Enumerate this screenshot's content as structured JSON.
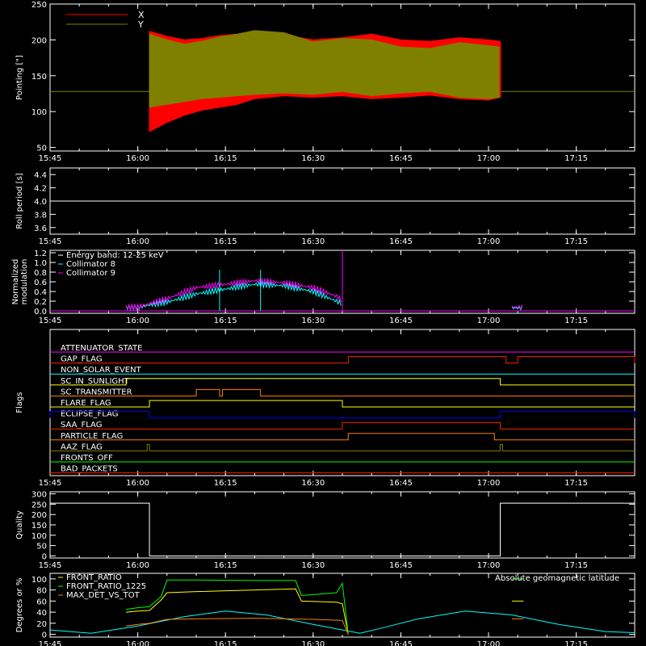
{
  "chart_data": [
    {
      "type": "area",
      "ylabel": "Pointing [\"]",
      "ylim": [
        45,
        250
      ],
      "yticks": [
        50,
        100,
        150,
        200,
        250
      ],
      "x_range": [
        "15:45",
        "17:25"
      ],
      "x_ticks": [
        "15:45",
        "16:00",
        "16:15",
        "16:30",
        "16:45",
        "17:00",
        "17:15"
      ],
      "legend": {
        "placement": "top-left",
        "entries": [
          {
            "name": "X",
            "color": "#ff0000"
          },
          {
            "name": "Y",
            "color": "#808000"
          }
        ]
      },
      "baseline": 128,
      "envelope_x": [
        "16:02",
        "16:05",
        "16:08",
        "16:11",
        "16:14",
        "16:17",
        "16:20",
        "16:25",
        "16:30",
        "16:35",
        "16:40",
        "16:45",
        "16:50",
        "16:55",
        "17:00",
        "17:02"
      ],
      "series": [
        {
          "name": "X",
          "color": "#ff0000",
          "upper": [
            212,
            205,
            200,
            202,
            206,
            208,
            210,
            207,
            200,
            203,
            208,
            200,
            198,
            203,
            200,
            198
          ],
          "lower": [
            72,
            85,
            95,
            102,
            106,
            110,
            118,
            122,
            120,
            122,
            118,
            120,
            123,
            118,
            116,
            120
          ]
        },
        {
          "name": "Y",
          "color": "#808000",
          "upper": [
            208,
            200,
            194,
            198,
            204,
            208,
            213,
            210,
            197,
            202,
            200,
            190,
            188,
            196,
            192,
            190
          ],
          "lower": [
            106,
            110,
            114,
            118,
            120,
            122,
            124,
            126,
            124,
            128,
            122,
            126,
            128,
            120,
            118,
            120
          ]
        }
      ]
    },
    {
      "type": "line",
      "ylabel": "Roll period [s]",
      "ylim": [
        3.5,
        4.5
      ],
      "yticks": [
        "3.6",
        "3.8",
        "4.0",
        "4.2",
        "4.4"
      ],
      "x_ticks": [
        "15:45",
        "16:00",
        "16:15",
        "16:30",
        "16:45",
        "17:00",
        "17:15"
      ],
      "series": [
        {
          "name": "",
          "color": "#ffffff",
          "x": [
            "15:45",
            "17:25"
          ],
          "y": [
            4.0,
            4.0
          ]
        }
      ]
    },
    {
      "type": "line",
      "ylabel": "Normalized modulation",
      "ylim": [
        -0.05,
        1.25
      ],
      "yticks": [
        "0.0",
        "0.2",
        "0.4",
        "0.6",
        "0.8",
        "1.0",
        "1.2"
      ],
      "x_ticks": [
        "15:45",
        "16:00",
        "16:15",
        "16:30",
        "16:45",
        "17:00",
        "17:15"
      ],
      "legend": {
        "placement": "top-left",
        "entries": [
          {
            "name": "Energy band: 12-25 keV",
            "color": "#ffffff"
          },
          {
            "name": "Collimator 8",
            "color": "#00ffff"
          },
          {
            "name": "Collimator 9",
            "color": "#ff00ff"
          }
        ]
      },
      "series": [
        {
          "name": "Collimator 8",
          "color": "#00ffff",
          "x": [
            "15:58",
            "16:00",
            "16:02",
            "16:05",
            "16:10",
            "16:15",
            "16:20",
            "16:25",
            "16:30",
            "16:34",
            "16:35",
            "17:04",
            "17:06"
          ],
          "y": [
            0.07,
            0.07,
            0.12,
            0.18,
            0.35,
            0.45,
            0.55,
            0.52,
            0.4,
            0.2,
            0.15,
            0.06,
            0.06
          ]
        },
        {
          "name": "Collimator 9",
          "color": "#ff00ff",
          "x": [
            "15:58",
            "16:00",
            "16:02",
            "16:05",
            "16:10",
            "16:15",
            "16:20",
            "16:25",
            "16:30",
            "16:34",
            "16:35",
            "17:04",
            "17:06"
          ],
          "y": [
            0.08,
            0.08,
            0.15,
            0.25,
            0.48,
            0.55,
            0.62,
            0.58,
            0.48,
            0.3,
            0.22,
            0.08,
            0.08
          ]
        }
      ]
    },
    {
      "type": "line",
      "ylabel": "Flags",
      "x_ticks": [
        "15:45",
        "16:00",
        "16:15",
        "16:30",
        "16:45",
        "17:00",
        "17:15"
      ],
      "flags": [
        {
          "label": "ATTENUATOR_STATE",
          "color": "#ff00ff",
          "steps": []
        },
        {
          "label": "GAP_FLAG",
          "color": "#ff2000",
          "steps": [
            [
              "16:36",
              "17:03"
            ],
            [
              "17:05",
              "17:25"
            ]
          ]
        },
        {
          "label": "NON_SOLAR_EVENT",
          "color": "#00ffff",
          "steps": []
        },
        {
          "label": "SC_IN_SUNLIGHT",
          "color": "#ffff00",
          "steps": [
            [
              "15:58",
              "17:02"
            ]
          ]
        },
        {
          "label": "SC_TRANSMITTER",
          "color": "#ff8000",
          "steps": [
            [
              "16:10",
              "16:14"
            ],
            [
              "16:14.5",
              "16:21"
            ]
          ]
        },
        {
          "label": "FLARE_FLAG",
          "color": "#ffff00",
          "steps": [
            [
              "16:02",
              "16:35"
            ]
          ]
        },
        {
          "label": "ECLIPSE_FLAG",
          "color": "#0000ff",
          "steps": [
            [
              "15:45",
              "16:02"
            ],
            [
              "17:02",
              "17:25"
            ]
          ]
        },
        {
          "label": "SAA_FLAG",
          "color": "#ff2000",
          "steps": [
            [
              "16:35",
              "17:02"
            ]
          ]
        },
        {
          "label": "PARTICLE_FLAG",
          "color": "#ff8000",
          "steps": [
            [
              "16:36",
              "17:01"
            ]
          ]
        },
        {
          "label": "AAZ_FLAG",
          "color": "#808000",
          "steps": [
            [
              "16:01.6",
              "16:02"
            ],
            [
              "17:02",
              "17:02.4"
            ]
          ]
        },
        {
          "label": "FRONTS_OFF",
          "color": "#00ff00",
          "steps": []
        },
        {
          "label": "BAD_PACKETS",
          "color": "#ff2000",
          "steps": []
        }
      ]
    },
    {
      "type": "line",
      "ylabel": "Quality",
      "ylim": [
        -10,
        310
      ],
      "yticks": [
        "0",
        "50",
        "100",
        "150",
        "200",
        "250",
        "300"
      ],
      "x_ticks": [
        "15:45",
        "16:00",
        "16:15",
        "16:30",
        "16:45",
        "17:00",
        "17:15"
      ],
      "series": [
        {
          "name": "",
          "color": "#ffffff",
          "x": [
            "15:45",
            "16:02",
            "16:02",
            "17:02",
            "17:02",
            "17:25"
          ],
          "y": [
            255,
            255,
            0,
            0,
            255,
            255
          ]
        }
      ]
    },
    {
      "type": "line",
      "ylabel": "Degrees or %",
      "ylim": [
        -5,
        110
      ],
      "yticks": [
        "0",
        "20",
        "40",
        "60",
        "80",
        "100"
      ],
      "x_ticks": [
        "15:45",
        "16:00",
        "16:15",
        "16:30",
        "16:45",
        "17:00",
        "17:15"
      ],
      "legend": {
        "placement": "top-left",
        "entries": [
          {
            "name": "FRONT_RATIO",
            "color": "#ffff00"
          },
          {
            "name": "FRONT_RATIO_1225",
            "color": "#00ff00"
          },
          {
            "name": "MAX_DET_VS_TOT",
            "color": "#ff8000"
          }
        ]
      },
      "annotation": {
        "text": "Absolute geomagnetic latitude",
        "color": "#00ffff",
        "placement": "top-right"
      },
      "series": [
        {
          "name": "Absolute geomagnetic latitude",
          "color": "#00ffff",
          "x": [
            "15:45",
            "15:52",
            "16:00",
            "16:08",
            "16:15",
            "16:22",
            "16:30",
            "16:38",
            "16:42",
            "16:48",
            "16:56",
            "17:04",
            "17:12",
            "17:20",
            "17:25"
          ],
          "y": [
            8,
            2,
            15,
            32,
            42,
            35,
            18,
            2,
            12,
            28,
            42,
            35,
            18,
            5,
            3
          ]
        },
        {
          "name": "FRONT_RATIO",
          "color": "#ffff00",
          "x": [
            "15:58",
            "16:00",
            "16:02",
            "16:04",
            "16:05",
            "16:10",
            "16:20",
            "16:27",
            "16:28",
            "16:34",
            "16:35",
            "16:36",
            "17:04",
            "17:06"
          ],
          "y": [
            40,
            42,
            43,
            62,
            75,
            77,
            80,
            82,
            60,
            58,
            55,
            0,
            60,
            60
          ]
        },
        {
          "name": "FRONT_RATIO_1225",
          "color": "#00ff00",
          "x": [
            "15:58",
            "16:00",
            "16:02",
            "16:04",
            "16:05",
            "16:10",
            "16:20",
            "16:27",
            "16:28",
            "16:34",
            "16:35",
            "16:36",
            "17:04",
            "17:06"
          ],
          "y": [
            45,
            48,
            50,
            68,
            98,
            98,
            97,
            97,
            70,
            75,
            92,
            0,
            100,
            100
          ]
        },
        {
          "name": "MAX_DET_VS_TOT",
          "color": "#ff8000",
          "x": [
            "15:58",
            "16:00",
            "16:02",
            "16:05",
            "16:10",
            "16:20",
            "16:30",
            "16:35",
            "16:36",
            "17:04",
            "17:06"
          ],
          "y": [
            15,
            18,
            20,
            27,
            28,
            29,
            27,
            25,
            0,
            28,
            28
          ]
        }
      ]
    }
  ]
}
